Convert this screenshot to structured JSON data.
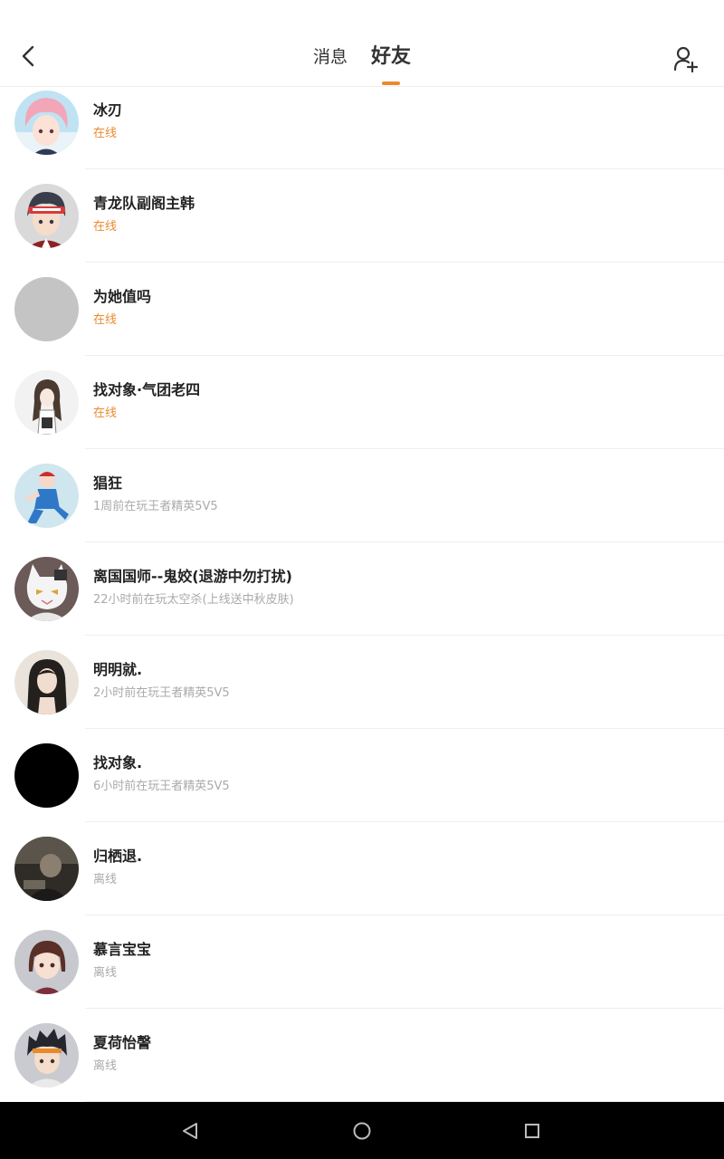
{
  "header": {
    "tabs": [
      {
        "label": "消息",
        "active": false
      },
      {
        "label": "好友",
        "active": true
      }
    ],
    "accent_color": "#ea8a2e",
    "icons": {
      "back": "chevron-left-icon",
      "add_friend": "add-user-icon"
    }
  },
  "friends": [
    {
      "name": "冰刃",
      "status": "在线",
      "online": true,
      "avatar": "avatar-pink-hair"
    },
    {
      "name": "青龙队副阁主韩",
      "status": "在线",
      "online": true,
      "avatar": "avatar-headband-boy"
    },
    {
      "name": "为她值吗",
      "status": "在线",
      "online": true,
      "avatar": "avatar-gray"
    },
    {
      "name": "找对象·气团老四",
      "status": "在线",
      "online": true,
      "avatar": "avatar-sketch-girl"
    },
    {
      "name": "猖狂",
      "status": "1周前在玩王者精英5V5",
      "online": false,
      "avatar": "avatar-blue-figure"
    },
    {
      "name": "离国国师--鬼姣(退游中勿打扰)",
      "status": "22小时前在玩太空杀(上线送中秋皮肤)",
      "online": false,
      "avatar": "avatar-white-cat"
    },
    {
      "name": "明明就.",
      "status": "2小时前在玩王者精英5V5",
      "online": false,
      "avatar": "avatar-photo-girl"
    },
    {
      "name": "找对象.",
      "status": "6小时前在玩王者精英5V5",
      "online": false,
      "avatar": "avatar-black"
    },
    {
      "name": "归栖退.",
      "status": "离线",
      "online": false,
      "avatar": "avatar-dark-photo"
    },
    {
      "name": "慕言宝宝",
      "status": "离线",
      "online": false,
      "avatar": "avatar-bob-girl"
    },
    {
      "name": "夏荷怡謦",
      "status": "离线",
      "online": false,
      "avatar": "avatar-spiky-boy"
    }
  ],
  "navbar": {
    "icons": [
      "nav-back-icon",
      "nav-home-icon",
      "nav-recents-icon"
    ]
  }
}
